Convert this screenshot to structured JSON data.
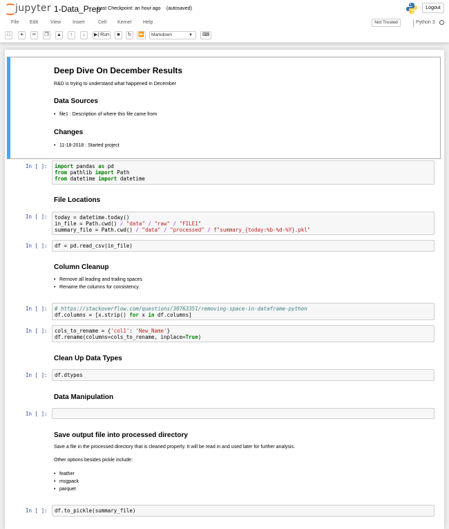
{
  "header": {
    "logo_text": "jupyter",
    "notebook_name": "1-Data_Prep",
    "checkpoint": "Last Checkpoint: an hour ago",
    "autosave": "(autosaved)",
    "logout": "Logout"
  },
  "menu": [
    "File",
    "Edit",
    "View",
    "Insert",
    "Cell",
    "Kernel",
    "Help"
  ],
  "status": {
    "trusted": "Not Trusted",
    "kernel": "Python 3"
  },
  "toolbar": {
    "run_label": "Run",
    "cell_type": "Markdown"
  },
  "intro": {
    "title": "Deep Dive On December Results",
    "subtitle": "R&D is trying to understand what happened in December",
    "sources_heading": "Data Sources",
    "sources_item": "file1 : Description of where this file came from",
    "changes_heading": "Changes",
    "changes_item": "11-18-2018 : Started project"
  },
  "prompt": "In [ ]:",
  "code1": {
    "l1_kw1": "import",
    "l1_mod": " pandas ",
    "l1_kw2": "as",
    "l1_alias": " pd",
    "l2_kw1": "from",
    "l2_mod": " pathlib ",
    "l2_kw2": "import",
    "l2_name": " Path",
    "l3_kw1": "from",
    "l3_mod": " datetime ",
    "l3_kw2": "import",
    "l3_name": " datetime"
  },
  "file_locations_heading": "File Locations",
  "code2": {
    "l1": "today = datetime.today()",
    "l2_a": "in_file = Path.cwd() ",
    "l2_op1": "/",
    "l2_s1": " \"data\" ",
    "l2_op2": "/",
    "l2_s2": " \"raw\" ",
    "l2_op3": "/",
    "l2_s3": " \"FILE1\"",
    "l3_a": "summary_file = Path.cwd() ",
    "l3_op1": "/",
    "l3_s1": " \"data\" ",
    "l3_op2": "/",
    "l3_s2": " \"processed\" ",
    "l3_op3": "/",
    "l3_s3": " f\"summary_{today:%b-%d-%Y}.pkl\""
  },
  "code3": "df = pd.read_csv(in_file)",
  "cleanup": {
    "heading": "Column Cleanup",
    "item1": "Remove all leading and trailing spaces",
    "item2": "Rename the columns for consistency."
  },
  "code4": {
    "comment": "# https://stackoverflow.com/questions/30763351/removing-space-in-dataframe-python",
    "l2_a": "df.columns = [x.strip() ",
    "l2_kw1": "for",
    "l2_b": " x ",
    "l2_kw2": "in",
    "l2_c": " df.columns]"
  },
  "code5": {
    "l1_a": "cols_to_rename = {",
    "l1_s1": "'col1'",
    "l1_b": ": ",
    "l1_s2": "'New_Name'",
    "l1_c": "}",
    "l2_a": "df.rename(columns=cols_to_rename, inplace=",
    "l2_kw": "True",
    "l2_c": ")"
  },
  "dtypes_heading": "Clean Up Data Types",
  "code6": "df.dtypes",
  "manip_heading": "Data Manipulation",
  "save": {
    "heading": "Save output file into processed directory",
    "para1": "Save a file in the processed directory that is cleaned properly. It will be read in and used later for further analysis.",
    "para2": "Other options besides pickle include:",
    "items": [
      "feather",
      "msgpack",
      "parquet"
    ]
  },
  "code8": "df.to_pickle(summary_file)"
}
